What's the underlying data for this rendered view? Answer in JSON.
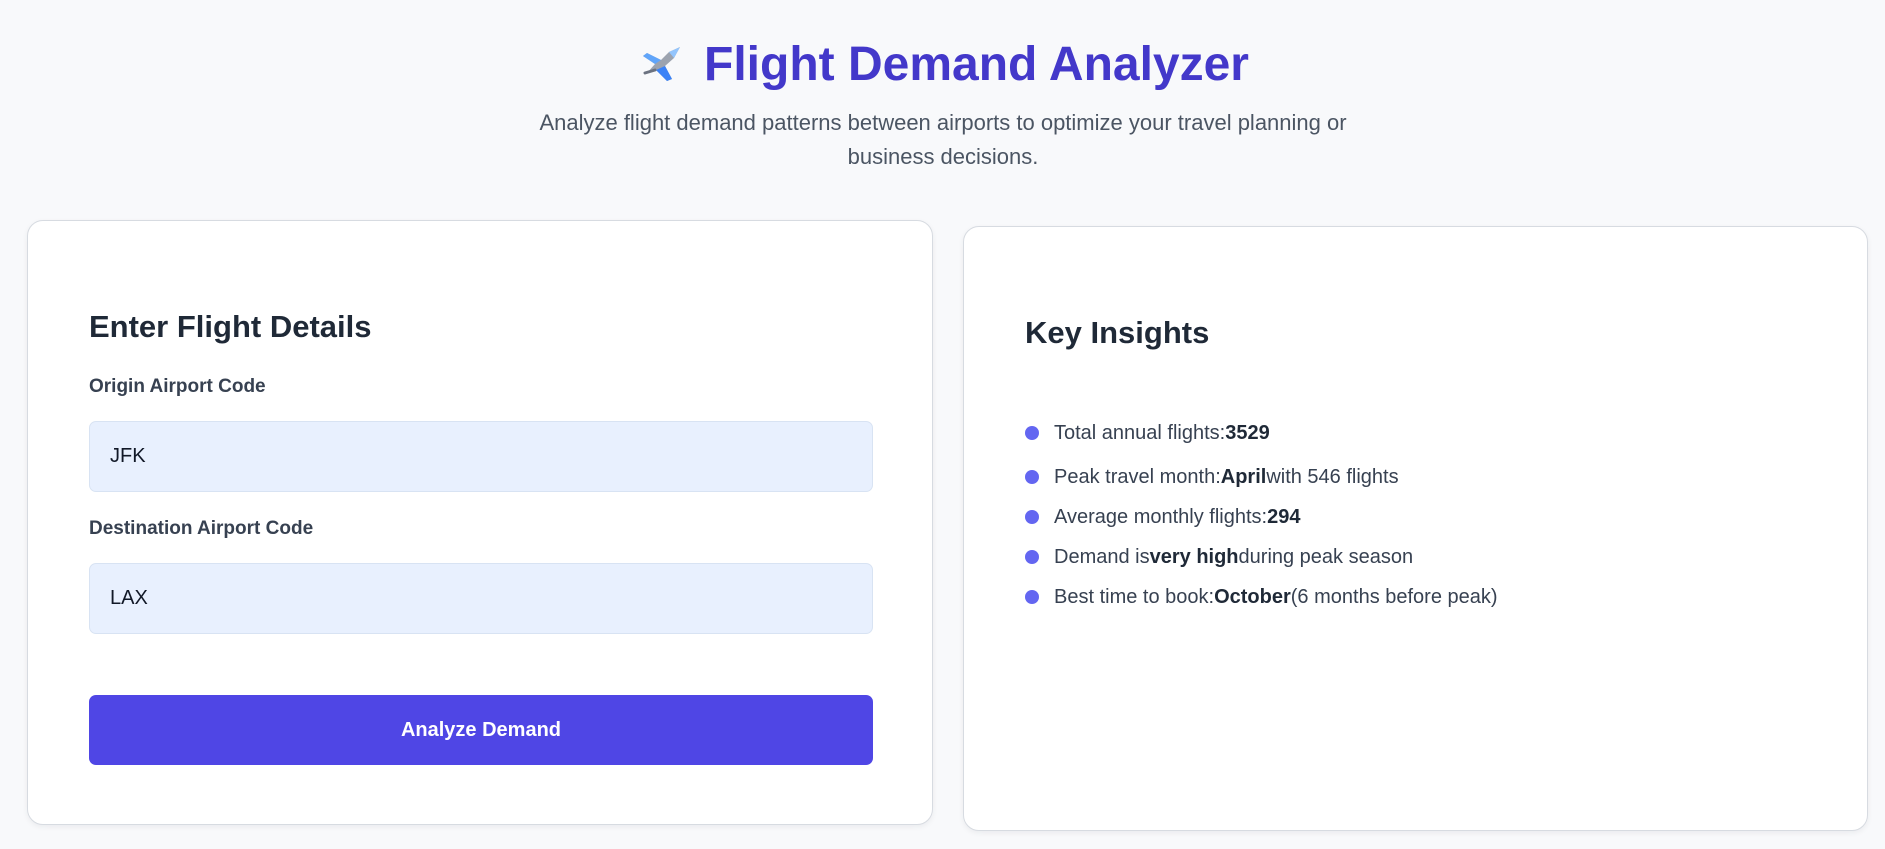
{
  "header": {
    "title": "Flight Demand Analyzer",
    "subtitle": "Analyze flight demand patterns between airports to optimize your travel planning or business decisions.",
    "title_icon": "airplane-icon",
    "accent_color": "#4338ca"
  },
  "form": {
    "title": "Enter Flight Details",
    "origin": {
      "label": "Origin Airport Code",
      "value": "JFK"
    },
    "destination": {
      "label": "Destination Airport Code",
      "value": "LAX"
    },
    "button_label": "Analyze Demand",
    "button_color": "#4f46e5",
    "input_background": "#e8f0fe"
  },
  "insights": {
    "title": "Key Insights",
    "bullet_color": "#6366f1",
    "items": [
      {
        "prefix": "Total annual flights: ",
        "strong": "3529",
        "suffix": ""
      },
      {
        "prefix": "Peak travel month: ",
        "strong": "April",
        "suffix": " with 546 flights"
      },
      {
        "prefix": "Average monthly flights: ",
        "strong": "294",
        "suffix": ""
      },
      {
        "prefix": "Demand is ",
        "strong": "very high",
        "suffix": " during peak season"
      },
      {
        "prefix": "Best time to book: ",
        "strong": "October",
        "suffix": " (6 months before peak)"
      }
    ]
  }
}
